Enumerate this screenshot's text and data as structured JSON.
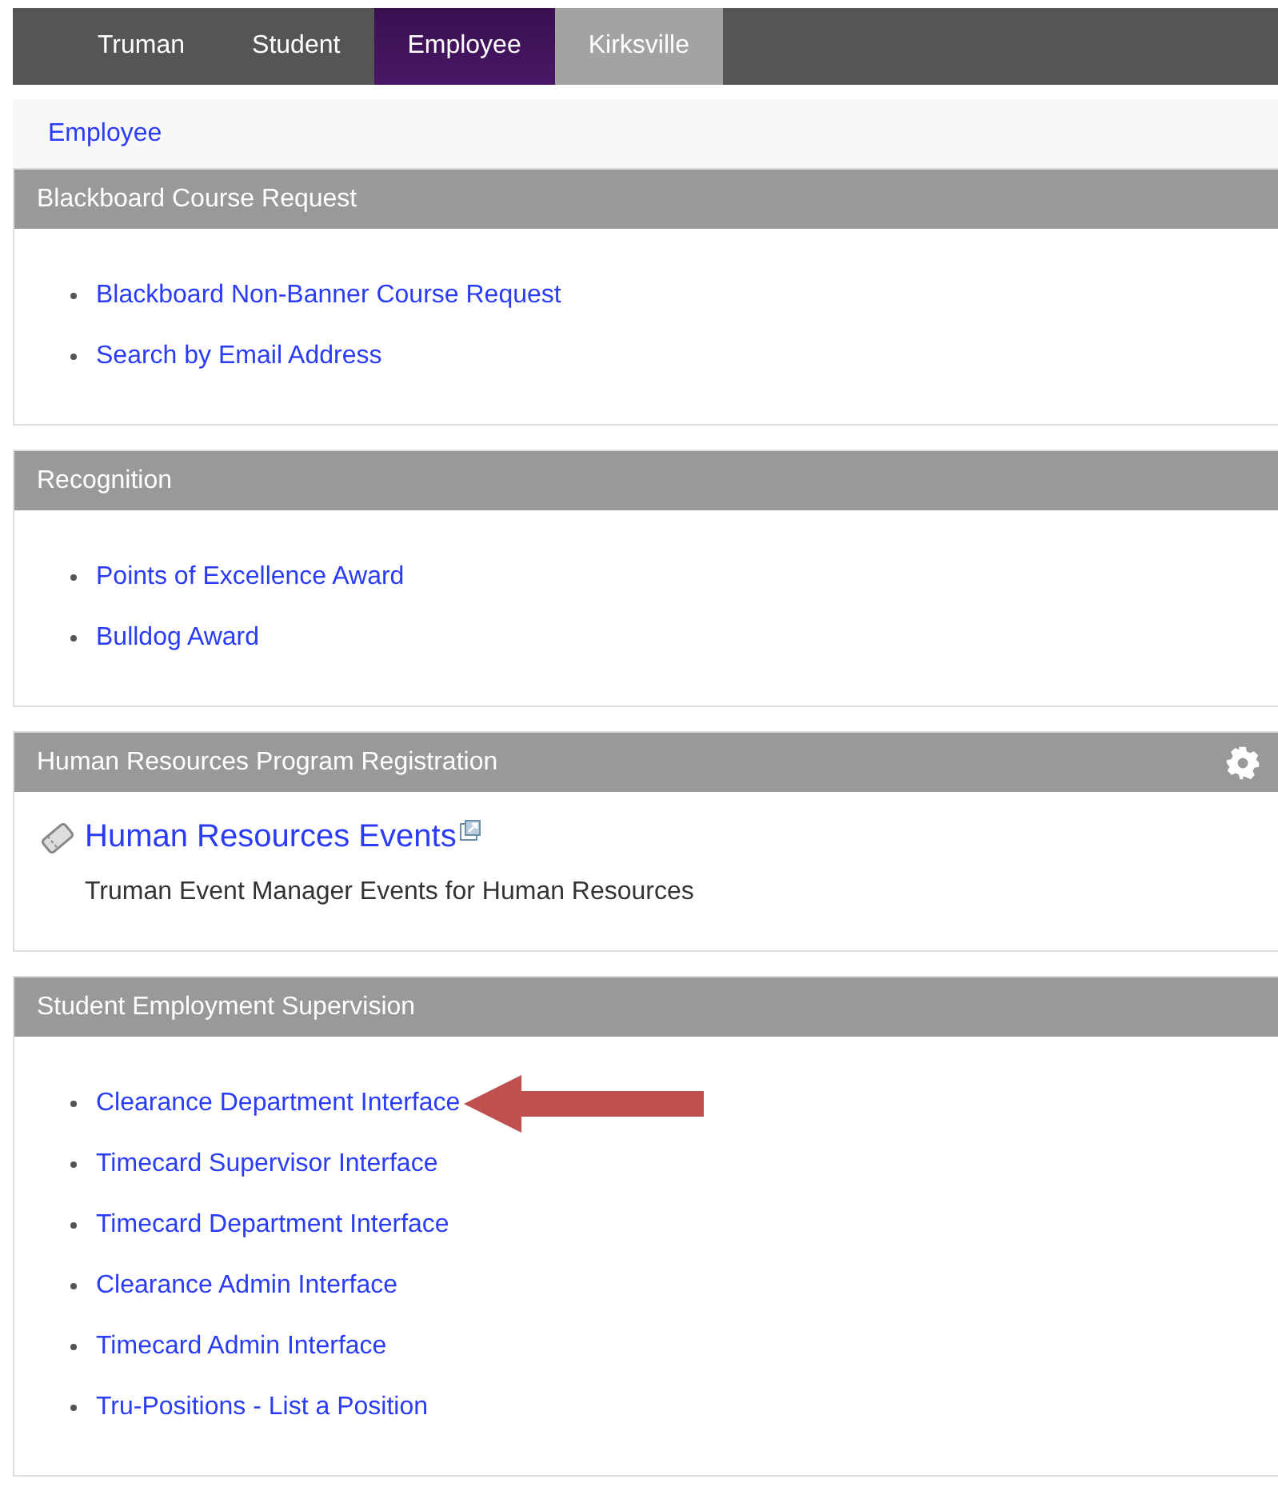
{
  "tabs": [
    {
      "label": "Truman",
      "selected": false,
      "highlighted": false
    },
    {
      "label": "Student",
      "selected": false,
      "highlighted": false
    },
    {
      "label": "Employee",
      "selected": true,
      "highlighted": false
    },
    {
      "label": "Kirksville",
      "selected": false,
      "highlighted": true
    }
  ],
  "breadcrumb": "Employee",
  "panels": [
    {
      "title": "Blackboard Course Request",
      "settings": false,
      "kind": "links",
      "items": [
        {
          "label": "Blackboard Non-Banner Course Request",
          "annotated": false
        },
        {
          "label": "Search by Email Address",
          "annotated": false
        }
      ]
    },
    {
      "title": "Recognition",
      "settings": false,
      "kind": "links",
      "items": [
        {
          "label": "Points of Excellence Award",
          "annotated": false
        },
        {
          "label": "Bulldog Award",
          "annotated": false
        }
      ]
    },
    {
      "title": "Human Resources Program Registration",
      "settings": true,
      "kind": "event",
      "event": {
        "label": "Human Resources Events",
        "description": "Truman Event Manager Events for Human Resources"
      }
    },
    {
      "title": "Student Employment Supervision",
      "settings": false,
      "kind": "links",
      "items": [
        {
          "label": "Clearance Department Interface",
          "annotated": true
        },
        {
          "label": "Timecard Supervisor Interface",
          "annotated": false
        },
        {
          "label": "Timecard Department Interface",
          "annotated": false
        },
        {
          "label": "Clearance Admin Interface",
          "annotated": false
        },
        {
          "label": "Timecard Admin Interface",
          "annotated": false
        },
        {
          "label": "Tru-Positions - List a Position",
          "annotated": false
        }
      ]
    }
  ]
}
